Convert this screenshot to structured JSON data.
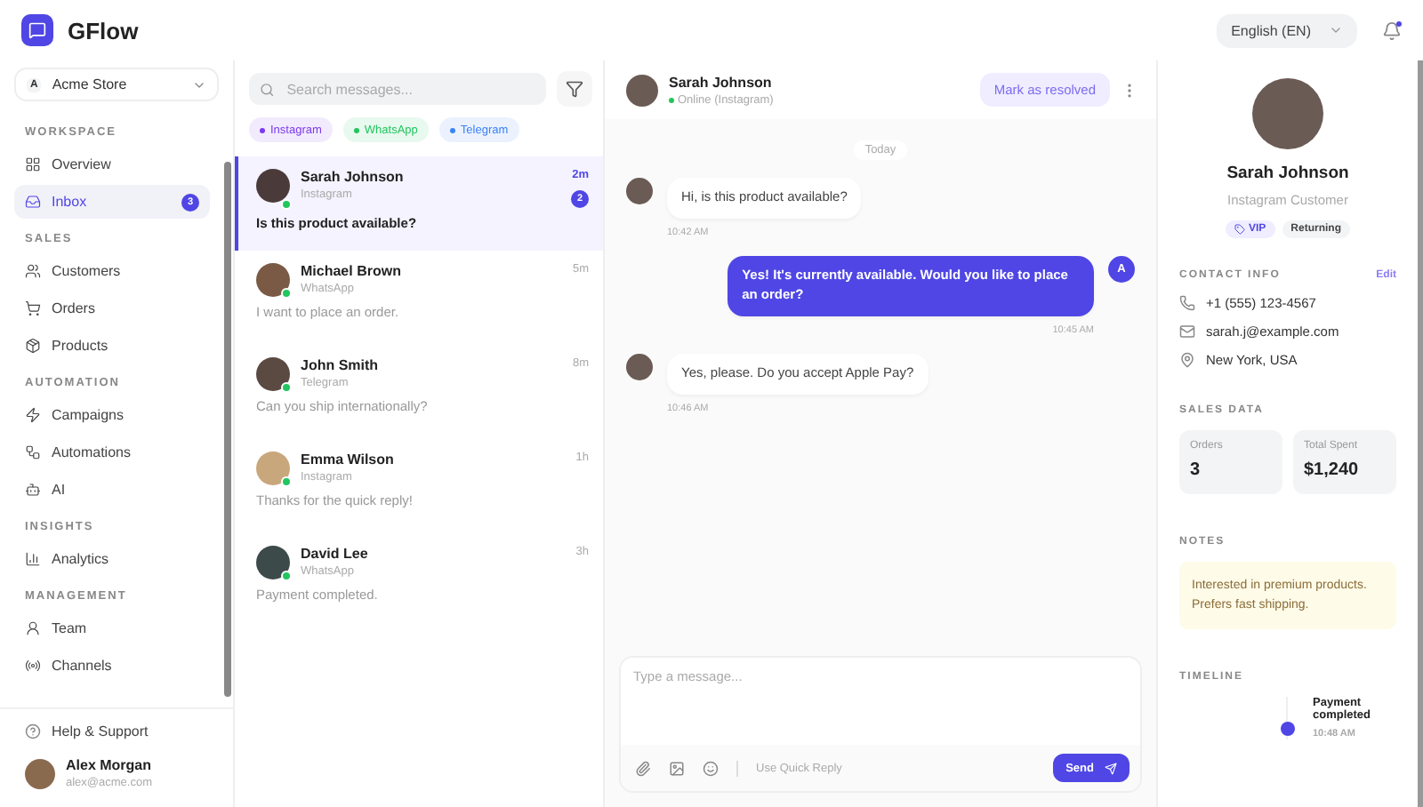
{
  "app": {
    "name": "GFlow"
  },
  "header": {
    "language": "English (EN)",
    "notifications_unread": true
  },
  "sidebar": {
    "store": {
      "initial": "A",
      "name": "Acme Store"
    },
    "sections": [
      {
        "title": "WORKSPACE",
        "items": [
          {
            "label": "Overview",
            "selected": false
          },
          {
            "label": "Inbox",
            "selected": true,
            "badge": "3"
          }
        ]
      },
      {
        "title": "SALES",
        "items": [
          {
            "label": "Customers",
            "selected": false
          },
          {
            "label": "Orders",
            "selected": false
          },
          {
            "label": "Products",
            "selected": false
          }
        ]
      },
      {
        "title": "AUTOMATION",
        "items": [
          {
            "label": "Campaigns",
            "selected": false
          },
          {
            "label": "Automations",
            "selected": false
          },
          {
            "label": "AI",
            "selected": false
          }
        ]
      },
      {
        "title": "INSIGHTS",
        "items": [
          {
            "label": "Analytics",
            "selected": false
          }
        ]
      },
      {
        "title": "MANAGEMENT",
        "items": [
          {
            "label": "Team",
            "selected": false
          },
          {
            "label": "Channels",
            "selected": false
          }
        ]
      }
    ],
    "help": "Help & Support",
    "user": {
      "name": "Alex Morgan",
      "email": "alex@acme.com"
    }
  },
  "conversations": {
    "search_placeholder": "Search messages...",
    "filters": [
      {
        "label": "Instagram",
        "color": "#7c3aed"
      },
      {
        "label": "WhatsApp",
        "color": "#22c55e"
      },
      {
        "label": "Telegram",
        "color": "#3b82f6"
      }
    ],
    "items": [
      {
        "name": "Sarah Johnson",
        "channel": "Instagram",
        "time": "2m",
        "preview": "Is this product available?",
        "selected": true,
        "unread": "2"
      },
      {
        "name": "Michael Brown",
        "channel": "WhatsApp",
        "time": "5m",
        "preview": "I want to place an order.",
        "selected": false
      },
      {
        "name": "John Smith",
        "channel": "Telegram",
        "time": "8m",
        "preview": "Can you ship internationally?",
        "selected": false
      },
      {
        "name": "Emma Wilson",
        "channel": "Instagram",
        "time": "1h",
        "preview": "Thanks for the quick reply!",
        "selected": false
      },
      {
        "name": "David Lee",
        "channel": "WhatsApp",
        "time": "3h",
        "preview": "Payment completed.",
        "selected": false
      }
    ]
  },
  "chat": {
    "contact": {
      "name": "Sarah Johnson",
      "status": "Online (Instagram)",
      "online": true
    },
    "resolve_button": "Mark as resolved",
    "date_divider": "Today",
    "messages": [
      {
        "kind": "customer",
        "text": "Hi, is this product available?",
        "time": "10:42 AM"
      },
      {
        "kind": "agent",
        "text": "Yes! It's currently available. Would you like to place an order?",
        "time": "10:45 AM",
        "avatar": "A"
      },
      {
        "kind": "customer",
        "text": "Yes, please. Do you accept Apple Pay?",
        "time": "10:46 AM"
      }
    ],
    "composer": {
      "placeholder": "Type a message...",
      "quick_reply": "Use Quick Reply",
      "send": "Send"
    }
  },
  "profile": {
    "name": "Sarah Johnson",
    "subtitle": "Instagram Customer",
    "tags": [
      {
        "label": "VIP",
        "kind": "vip"
      },
      {
        "label": "Returning",
        "kind": "plain"
      }
    ],
    "contact_title": "CONTACT INFO",
    "edit": "Edit",
    "contacts": [
      {
        "kind": "phone",
        "value": "+1 (555) 123-4567"
      },
      {
        "kind": "email",
        "value": "sarah.j@example.com"
      },
      {
        "kind": "location",
        "value": "New York, USA"
      }
    ],
    "sales_title": "SALES DATA",
    "stats": [
      {
        "label": "Orders",
        "value": "3"
      },
      {
        "label": "Total Spent",
        "value": "$1,240"
      }
    ],
    "notes_title": "NOTES",
    "note": "Interested in premium products. Prefers fast shipping.",
    "timeline_title": "TIMELINE",
    "timeline": [
      {
        "title": "Payment completed",
        "time": "10:48 AM"
      }
    ]
  }
}
